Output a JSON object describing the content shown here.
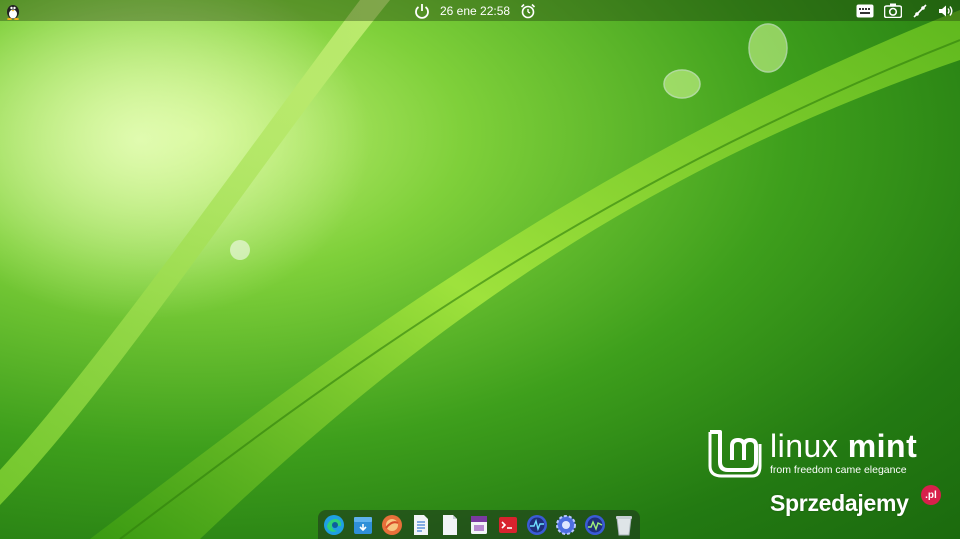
{
  "top_panel": {
    "clock": "26 ene 22:58",
    "left_icons": [
      "penguin-menu-icon"
    ],
    "center_icons": [
      "power-icon",
      "alarm-clock-icon"
    ],
    "right_icons": [
      "keyboard-icon",
      "camera-icon",
      "network-icon",
      "volume-icon"
    ]
  },
  "branding": {
    "name_light": "linux",
    "name_bold": "mint",
    "tagline": "from freedom came elegance"
  },
  "watermark": {
    "text": "Sprzedajemy",
    "suffix": ".pl"
  },
  "dock": {
    "items": [
      {
        "name": "edge-browser-icon",
        "color": "#1fa0e3"
      },
      {
        "name": "software-store-icon",
        "color": "#2f8fd8"
      },
      {
        "name": "firefox-like-icon",
        "color": "#e8703a"
      },
      {
        "name": "text-document-icon",
        "color": "#f2f4f7"
      },
      {
        "name": "blank-document-icon",
        "color": "#f2f4f7"
      },
      {
        "name": "calendar-app-icon",
        "color": "#7a3aa0"
      },
      {
        "name": "terminal-icon",
        "color": "#d8232e"
      },
      {
        "name": "system-monitor-icon",
        "color": "#3b5bd6"
      },
      {
        "name": "settings-gear-icon",
        "color": "#4d6ee0"
      },
      {
        "name": "activity-monitor-icon",
        "color": "#3b5bd6"
      },
      {
        "name": "trash-icon",
        "color": "#dfe5e8"
      }
    ]
  }
}
